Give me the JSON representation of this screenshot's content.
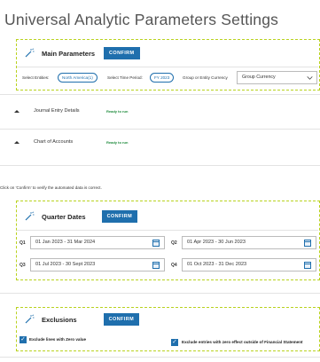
{
  "page": {
    "title": "Universal Analytic Parameters Settings"
  },
  "main_parameters": {
    "title": "Main Parameters",
    "confirm_label": "CONFIRM",
    "entities_label": "Select Entities:",
    "entities_value": "North America(1)",
    "period_label": "Select Time Period:",
    "period_value": "FY 2023",
    "currency_label": "Group or Entity Currency",
    "currency_value": "Group Currency"
  },
  "rows": [
    {
      "label": "Journal Entry Details",
      "status": "Ready to run"
    },
    {
      "label": "Chart of Accounts",
      "status": "Ready to run"
    }
  ],
  "note": "Click on 'Confirm' to verify the automated data is correct.",
  "quarter_dates": {
    "title": "Quarter Dates",
    "confirm_label": "CONFIRM",
    "quarters": [
      {
        "label": "Q1",
        "value": "01 Jan 2023 - 31 Mar 2024"
      },
      {
        "label": "Q2",
        "value": "01 Apr 2023 - 30 Jun 2023"
      },
      {
        "label": "Q3",
        "value": "01 Jul 2023 - 30 Sept 2023"
      },
      {
        "label": "Q4",
        "value": "01 Oct 2023 - 31 Dec 2023"
      }
    ]
  },
  "exclusions": {
    "title": "Exclusions",
    "confirm_label": "CONFIRM",
    "options": [
      {
        "label": "Exclude lines with Zero value",
        "checked": true
      },
      {
        "label": "Exclude entries with zero effect outside of Financial Statement",
        "checked": true
      }
    ]
  },
  "colors": {
    "accent": "#1f6fad",
    "dashed_border": "#b9d21f",
    "status_green": "#1e8b3c"
  }
}
